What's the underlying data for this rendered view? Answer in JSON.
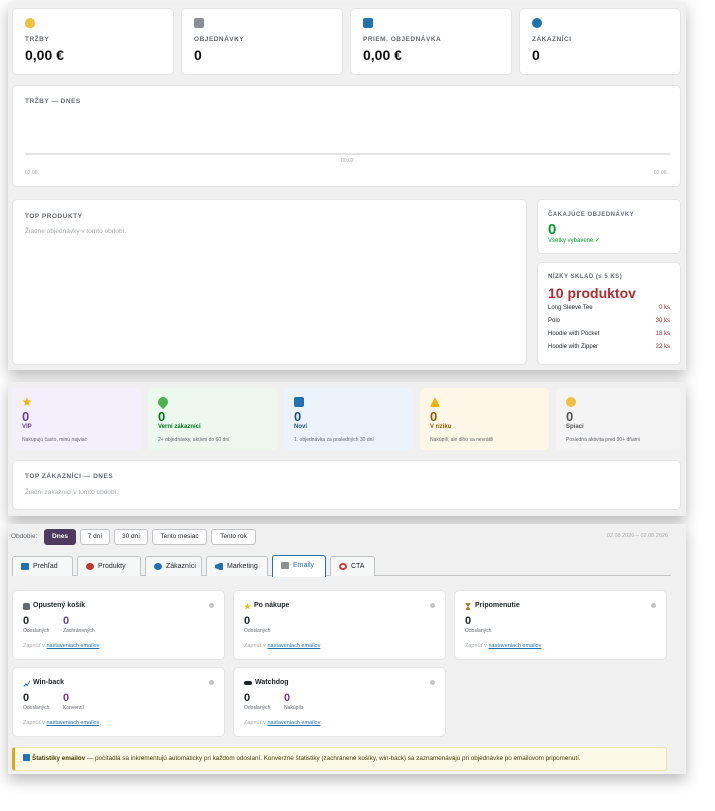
{
  "stats": [
    {
      "label": "TRŽBY",
      "value": "0,00 €",
      "icon": "money-bag-icon",
      "color": "#f0c040"
    },
    {
      "label": "OBJEDNÁVKY",
      "value": "0",
      "icon": "cart-icon",
      "color": "#8c8f94"
    },
    {
      "label": "PRIEM. OBJEDNÁVKA",
      "value": "0,00 €",
      "icon": "bar-chart-icon",
      "color": "#2271b1"
    },
    {
      "label": "ZÁKAZNÍCI",
      "value": "0",
      "icon": "users-icon",
      "color": "#2271b1"
    }
  ],
  "sales_chart": {
    "title": "TRŽBY — DNES",
    "x_labels": {
      "left": "02.08.",
      "mid": "00:02",
      "right": "02.08."
    },
    "chart_data": {
      "type": "line",
      "title": "TRŽBY — DNES",
      "x": [
        "02.08.",
        "00:02",
        "02.08."
      ],
      "series": [
        {
          "values": [
            0,
            0,
            0
          ]
        }
      ]
    }
  },
  "top_products": {
    "title": "TOP PRODUKTY",
    "empty": "Žiadne objednávky v tomto období."
  },
  "pending": {
    "title": "ČAKAJÚCE OBJEDNÁVKY",
    "value": "0",
    "status": "Všetky vybavené ✓"
  },
  "low_stock": {
    "title": "NÍZKY SKLAD (≤ 5 KS)",
    "count": "10 produktov",
    "items": [
      {
        "name": "Long Sleeve Tee",
        "qty": "0 ks"
      },
      {
        "name": "Polo",
        "qty": "30 ks"
      },
      {
        "name": "Hoodie with Pocket",
        "qty": "18 ks"
      },
      {
        "name": "Hoodie with Zipper",
        "qty": "22 ks"
      }
    ]
  },
  "segments": [
    {
      "name": "VIP",
      "value": "0",
      "desc": "Nakupujú často, minú najviac",
      "icon": "star-icon",
      "bg": "#f3f0fb",
      "color": "#6b3fa0"
    },
    {
      "name": "Verní zákazníci",
      "value": "0",
      "desc": "2+ objednávky, aktívni do 60 dní",
      "icon": "heart-icon",
      "bg": "#ecf7ee",
      "color": "#00741c"
    },
    {
      "name": "Noví",
      "value": "0",
      "desc": "1. objednávka za posledných 30 dní",
      "icon": "new-badge-icon",
      "bg": "#edf3fb",
      "color": "#1d4e89"
    },
    {
      "name": "V riziku",
      "value": "0",
      "desc": "Nakúpili, ale dlho sa nevrátili",
      "icon": "warning-icon",
      "bg": "#fcf7e6",
      "color": "#8a5a00"
    },
    {
      "name": "Spiaci",
      "value": "0",
      "desc": "Posledná aktivita pred 90+ dňami",
      "icon": "sleepy-face-icon",
      "bg": "#f4f4f4",
      "color": "#555555"
    }
  ],
  "top_customers": {
    "title": "TOP ZÁKAZNÍCI — DNES",
    "empty": "Žiadni zákazníci v tomto období."
  },
  "period": {
    "label": "Obdobie:",
    "buttons": [
      "Dnes",
      "7 dní",
      "30 dní",
      "Tento mesiac",
      "Tento rok"
    ],
    "active": "Dnes",
    "range": "02.08.2026 – 02.08.2026"
  },
  "tabs": [
    {
      "label": "Prehľad",
      "icon": "overview-icon",
      "color": "#2271b1"
    },
    {
      "label": "Produkty",
      "icon": "box-icon",
      "color": "#c0392b"
    },
    {
      "label": "Zákazníci",
      "icon": "users-icon",
      "color": "#2271b1"
    },
    {
      "label": "Marketing",
      "icon": "megaphone-icon",
      "color": "#2271b1"
    },
    {
      "label": "Emaily",
      "icon": "email-icon",
      "color": "#8c8f94"
    },
    {
      "label": "CTA",
      "icon": "target-icon",
      "color": "#d63638"
    }
  ],
  "active_tab": "Emaily",
  "email_cards": [
    {
      "title": "Opustený košík",
      "icon": "cart-icon",
      "stats": [
        {
          "value": "0",
          "label": "Odoslaných"
        },
        {
          "value": "0",
          "label": "Zachránených"
        }
      ],
      "link_prefix": "Zapnúť v ",
      "link": "nastaveniach emailov"
    },
    {
      "title": "Po nákupe",
      "icon": "star-icon",
      "stats": [
        {
          "value": "0",
          "label": "Odoslaných"
        }
      ],
      "link_prefix": "Zapnúť v ",
      "link": "nastaveniach emailov"
    },
    {
      "title": "Pripomenutie",
      "icon": "hourglass-icon",
      "stats": [
        {
          "value": "0",
          "label": "Odoslaných"
        }
      ],
      "link_prefix": "Zapnúť v ",
      "link": "nastaveniach emailov"
    },
    {
      "title": "Win-back",
      "icon": "trend-icon",
      "stats": [
        {
          "value": "0",
          "label": "Odoslaných"
        },
        {
          "value": "0",
          "label": "Konverzií"
        }
      ],
      "link_prefix": "Zapnúť v ",
      "link": "nastaveniach emailov"
    },
    {
      "title": "Watchdog",
      "icon": "eyes-icon",
      "stats": [
        {
          "value": "0",
          "label": "Odoslaných"
        },
        {
          "value": "0",
          "label": "Nakúpilo"
        }
      ],
      "link_prefix": "Zapnúť v ",
      "link": "nastaveniach emailov"
    }
  ],
  "info": {
    "icon": "info-icon",
    "bold": "Štatistiky emailov",
    "text": " — počítadlá sa inkrementujú automaticky pri každom odoslaní. Konverzné štatistiky (zachránené košíky, win-back) sa zaznamenávajú pri objednávke po emailovom pripomenutí."
  }
}
